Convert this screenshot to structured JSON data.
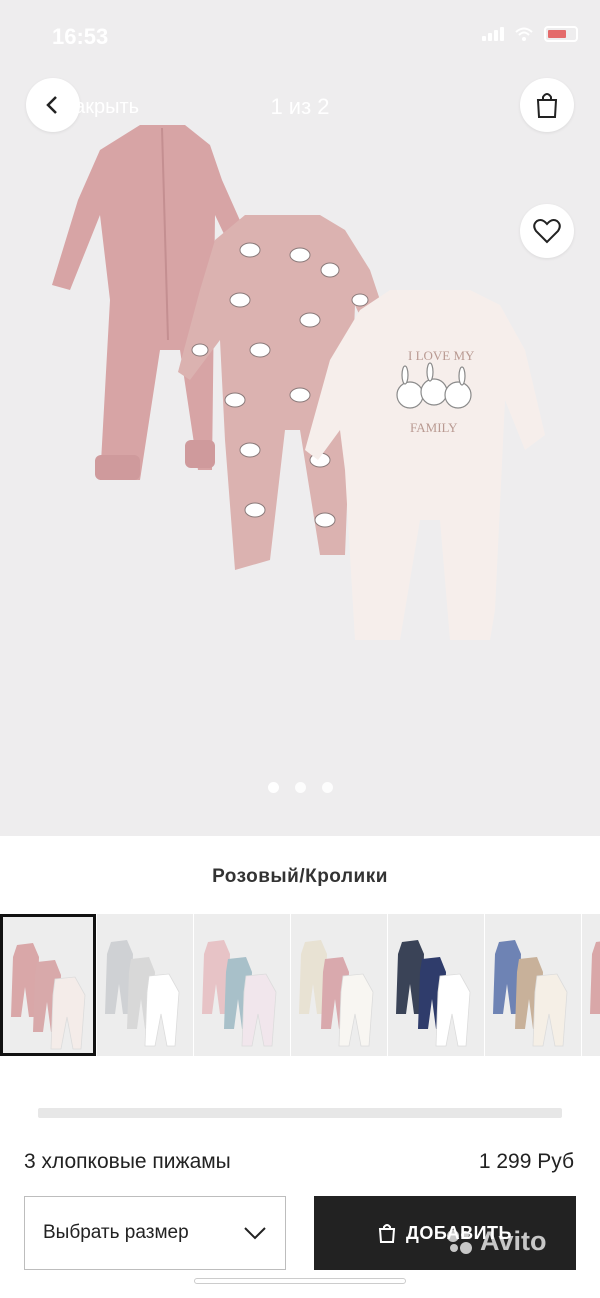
{
  "status_bar": {
    "time": "16:53"
  },
  "header": {
    "close_label": "Закрыть",
    "page_indicator": "1 из 2"
  },
  "colors": {
    "pink": "#d9a7a8",
    "cream": "#f6efec",
    "bg_gray": "#eeedee",
    "button_dark": "#222222"
  },
  "gallery": {
    "dots": 3,
    "active_index": 0
  },
  "color_selector": {
    "selected_name": "Розовый/Кролики",
    "thumbnails": [
      {
        "name": "Розовый/Кролики",
        "colors": [
          "#d9a7a8",
          "#d8a9aa",
          "#f4ece9"
        ],
        "selected": true
      },
      {
        "name": "grey-white",
        "colors": [
          "#cfd1d4",
          "#d8d8d8",
          "#ffffff"
        ],
        "selected": false
      },
      {
        "name": "pink-teal-floral",
        "colors": [
          "#e7c3c6",
          "#a8c0c9",
          "#f1e6ec"
        ],
        "selected": false
      },
      {
        "name": "cream-dots",
        "colors": [
          "#e8e2d3",
          "#d9a9ad",
          "#f8f6f2"
        ],
        "selected": false
      },
      {
        "name": "navy-stripes",
        "colors": [
          "#3a4357",
          "#2f3c6b",
          "#ffffff"
        ],
        "selected": false
      },
      {
        "name": "blue-beige-bear",
        "colors": [
          "#6e83b4",
          "#c8b19a",
          "#f5efe6"
        ],
        "selected": false
      },
      {
        "name": "partial",
        "colors": [
          "#d9a7a8",
          "#d9a7a8",
          "#d9a7a8"
        ],
        "selected": false
      }
    ]
  },
  "product": {
    "name": "3 хлопковые пижамы",
    "price": "1 299 Руб"
  },
  "actions": {
    "size_label": "Выбрать размер",
    "add_label": "ДОБАВИТЬ"
  },
  "watermark": "Avito"
}
